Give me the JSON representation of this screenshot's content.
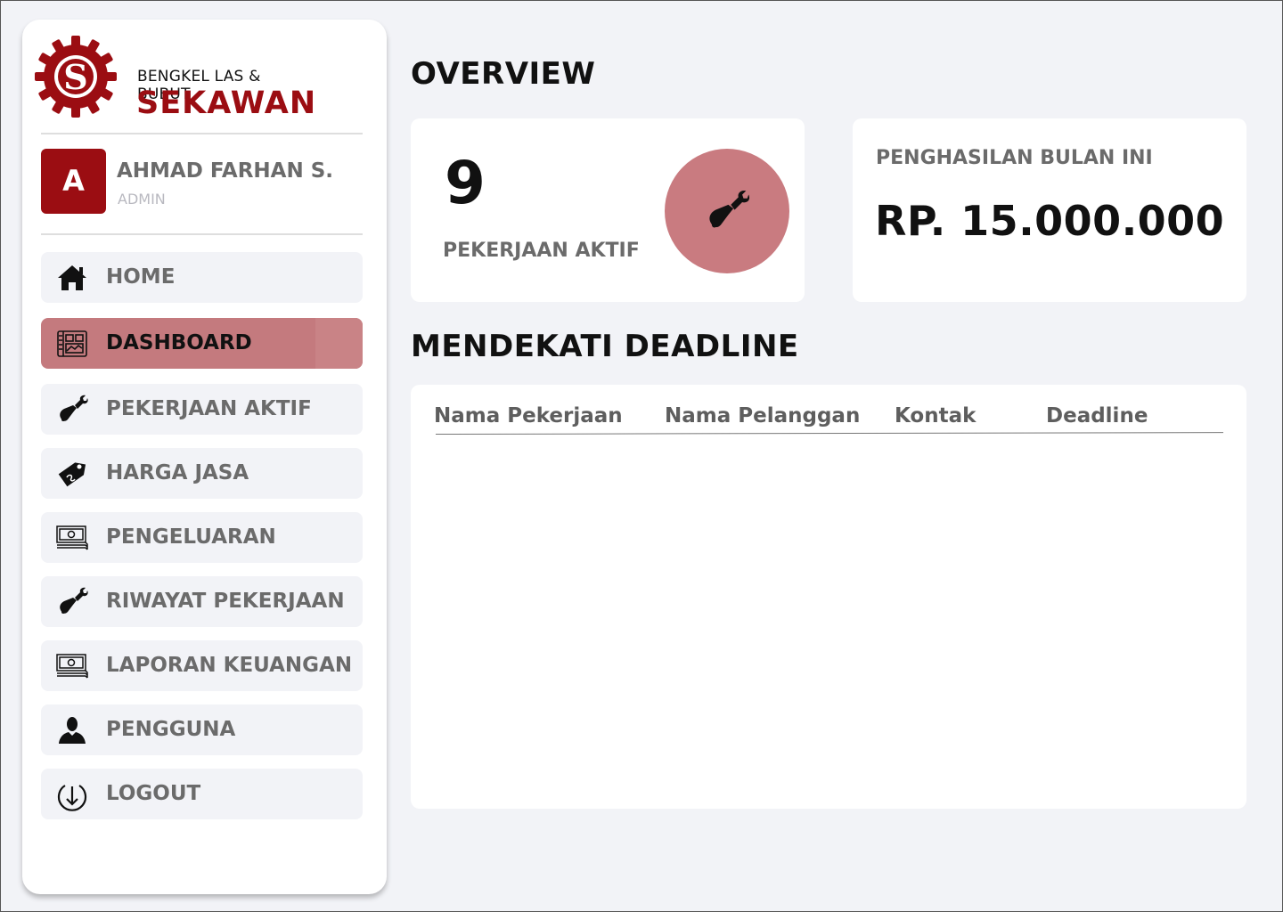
{
  "brand": {
    "subtitle": "BENGKEL LAS & BUBUT",
    "name": "SEKAWAN",
    "logo_letter": "S",
    "color": "#9b0d12"
  },
  "user": {
    "initial": "A",
    "name": "AHMAD FARHAN S.",
    "role": "ADMIN"
  },
  "sidebar": {
    "items": [
      {
        "label": "HOME",
        "icon": "home-icon",
        "active": false
      },
      {
        "label": "DASHBOARD",
        "icon": "dashboard-icon",
        "active": true
      },
      {
        "label": "PEKERJAAN AKTIF",
        "icon": "wrench-hand-icon",
        "active": false
      },
      {
        "label": "HARGA JASA",
        "icon": "price-tag-icon",
        "active": false
      },
      {
        "label": "PENGELUARAN",
        "icon": "money-stack-icon",
        "active": false
      },
      {
        "label": "RIWAYAT PEKERJAAN",
        "icon": "wrench-hand-icon",
        "active": false
      },
      {
        "label": "LAPORAN KEUANGAN",
        "icon": "money-stack-icon",
        "active": false
      },
      {
        "label": "PENGGUNA",
        "icon": "user-icon",
        "active": false
      },
      {
        "label": "LOGOUT",
        "icon": "logout-icon",
        "active": false
      }
    ]
  },
  "overview": {
    "title": "OVERVIEW",
    "active_jobs": {
      "value": "9",
      "label": "PEKERJAAN AKTIF",
      "icon": "wrench-hand-icon"
    },
    "income": {
      "label": "PENGHASILAN BULAN INI",
      "value": "RP. 15.000.000"
    }
  },
  "deadline": {
    "title": "MENDEKATI DEADLINE",
    "columns": [
      "Nama Pekerjaan",
      "Nama Pelanggan",
      "Kontak",
      "Deadline"
    ],
    "rows": []
  },
  "colors": {
    "accent": "#c97b80",
    "active_nav": "#c47a7e",
    "background": "#f2f3f7"
  }
}
